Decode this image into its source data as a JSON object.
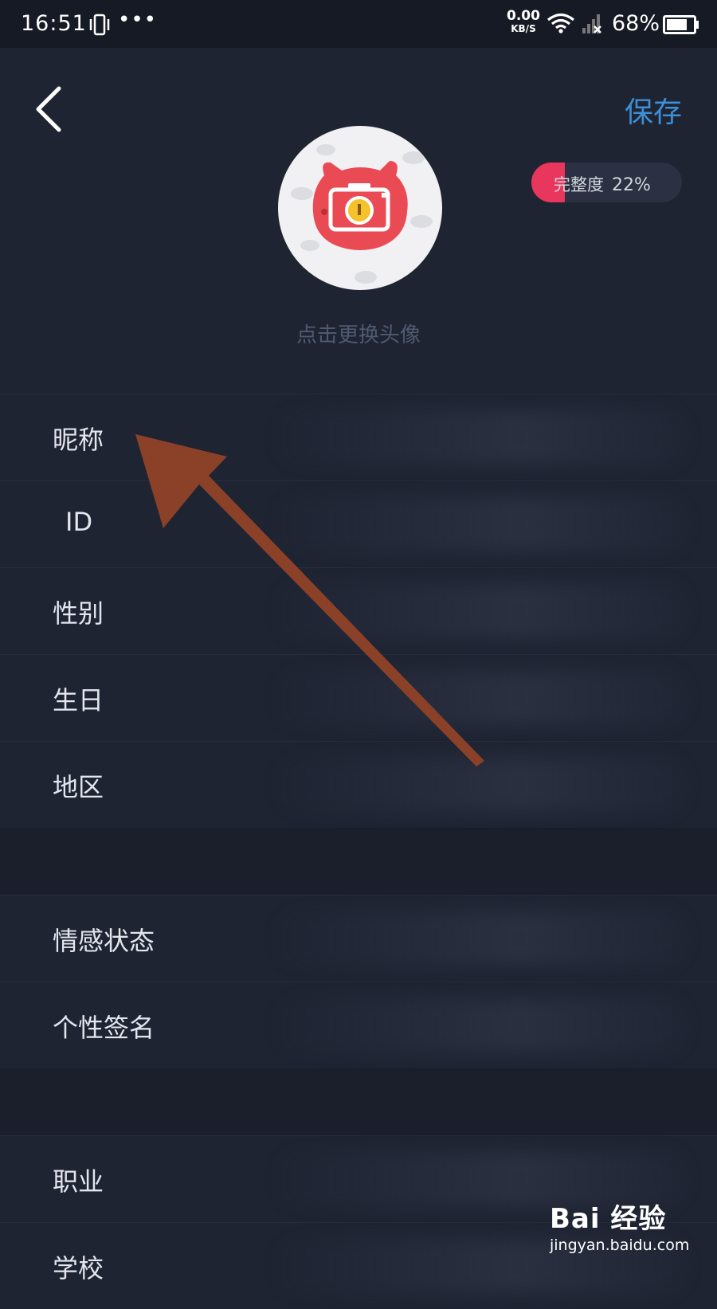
{
  "status_bar": {
    "time": "16:51",
    "dots": "•••",
    "net_speed": "0.00",
    "net_unit": "KB/S",
    "battery_percent": "68%"
  },
  "header": {
    "save_label": "保存",
    "change_avatar_label": "点击更换头像",
    "completeness_label": "完整度",
    "completeness_value": "22%",
    "completeness_fraction": 0.22
  },
  "fields": [
    {
      "label": "昵称"
    },
    {
      "label": "ID"
    },
    {
      "label": "性别"
    },
    {
      "label": "生日"
    },
    {
      "label": "地区"
    },
    {
      "label": "情感状态"
    },
    {
      "label": "个性签名"
    },
    {
      "label": "职业"
    },
    {
      "label": "学校"
    }
  ],
  "colors": {
    "accent": "#3d8fd6",
    "progress": "#e8365d",
    "annotation_arrow": "#8a4128"
  },
  "watermark": {
    "brand": "Bai 经验",
    "url": "jingyan.baidu.com"
  }
}
